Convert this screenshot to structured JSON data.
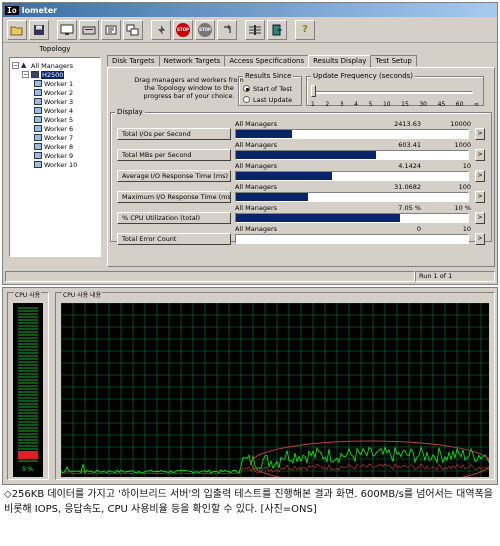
{
  "window": {
    "logo": "Io",
    "title": "Iometer"
  },
  "toolbar": {
    "stop_label": "STOP",
    "stop_all_label": "STOP",
    "help_label": "?"
  },
  "topology": {
    "label": "Topology",
    "items": [
      {
        "label": "All Managers",
        "kind": "all",
        "box": "−"
      },
      {
        "label": "H2500",
        "kind": "manager",
        "box": "−"
      },
      {
        "label": "Worker 1",
        "kind": "worker"
      },
      {
        "label": "Worker 2",
        "kind": "worker"
      },
      {
        "label": "Worker 3",
        "kind": "worker"
      },
      {
        "label": "Worker 4",
        "kind": "worker"
      },
      {
        "label": "Worker 5",
        "kind": "worker"
      },
      {
        "label": "Worker 6",
        "kind": "worker"
      },
      {
        "label": "Worker 7",
        "kind": "worker"
      },
      {
        "label": "Worker 8",
        "kind": "worker"
      },
      {
        "label": "Worker 9",
        "kind": "worker"
      },
      {
        "label": "Worker 10",
        "kind": "worker"
      }
    ]
  },
  "tabs": [
    "Disk Targets",
    "Network Targets",
    "Access Specifications",
    "Results Display",
    "Test Setup"
  ],
  "results": {
    "drag_hint": "Drag managers and workers from the Topology window to the progress bar of your choice.",
    "since_title": "Results Since",
    "since_options": [
      "Start of Test",
      "Last Update"
    ],
    "update_title": "Update Frequency (seconds)",
    "update_ticks": [
      "1",
      "2",
      "3",
      "4",
      "5",
      "10",
      "15",
      "30",
      "45",
      "60",
      "∞"
    ],
    "display_title": "Display",
    "metrics": [
      {
        "label": "Total I/Os per Second",
        "source": "All Managers",
        "value": "2413.63",
        "max": "10000",
        "fraction": 0.241
      },
      {
        "label": "Total MBs per Second",
        "source": "All Managers",
        "value": "603.41",
        "max": "1000",
        "fraction": 0.603
      },
      {
        "label": "Average I/O Response Time (ms)",
        "source": "All Managers",
        "value": "4.1424",
        "max": "10",
        "fraction": 0.414
      },
      {
        "label": "Maximum I/O Response Time (ms)",
        "source": "All Managers",
        "value": "31.0682",
        "max": "100",
        "fraction": 0.311
      },
      {
        "label": "% CPU Utilization (total)",
        "source": "All Managers",
        "value": "7.05 %",
        "max": "10 %",
        "fraction": 0.705
      },
      {
        "label": "Total Error Count",
        "source": "All Managers",
        "value": "0",
        "max": "10",
        "fraction": 0
      }
    ],
    "arrow": ">"
  },
  "status": {
    "run": "Run 1 of 1"
  },
  "taskmanager": {
    "cpu_usage_label": "CPU 사용",
    "cpu_history_label": "CPU 사용 내용",
    "cpu_percent_text": "5 %",
    "colors": {
      "grid": "#00803a",
      "line": "#00ff00",
      "highlight_circle": "#c04040"
    }
  },
  "caption": "◇256KB 데이터를 가지고 '하이브리드 서버'의 입출력 테스트를 진행해본 결과 화면. 600MB/s를 넘어서는 대역폭을 비롯해 IOPS, 응답속도, CPU 사용비율 등을 확인할 수 있다. [사진=ONS]"
}
